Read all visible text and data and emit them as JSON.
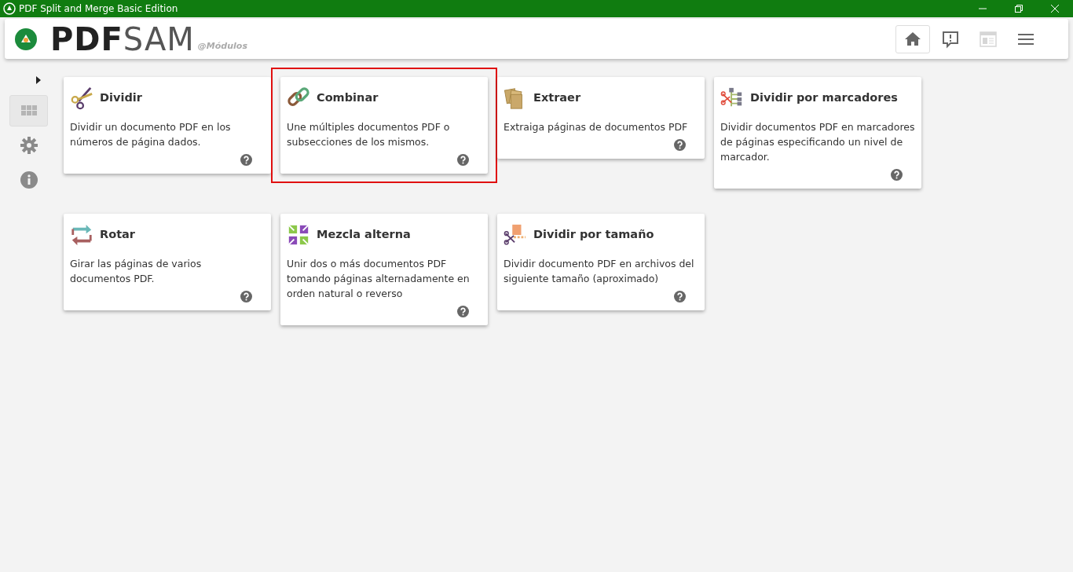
{
  "window": {
    "title": "PDF Split and Merge Basic Edition"
  },
  "header": {
    "logo_dark": "PDF",
    "logo_light": "SAM",
    "section": "@Módulos",
    "buttons": [
      {
        "kind": "home",
        "selected": true,
        "disabled": false
      },
      {
        "kind": "feedback",
        "selected": false,
        "disabled": false
      },
      {
        "kind": "news",
        "selected": false,
        "disabled": true
      },
      {
        "kind": "menu",
        "selected": false,
        "disabled": false
      }
    ]
  },
  "sidebar": {
    "items": [
      {
        "kind": "modules",
        "selected": true
      },
      {
        "kind": "settings",
        "selected": false
      },
      {
        "kind": "info",
        "selected": false
      }
    ]
  },
  "modules": [
    {
      "kind": "split",
      "title": "Dividir",
      "description": "Dividir un documento PDF en los números de página dados.",
      "highlighted": false
    },
    {
      "kind": "merge",
      "title": "Combinar",
      "description": "Une múltiples documentos PDF o subsecciones de los mismos.",
      "highlighted": true
    },
    {
      "kind": "extract",
      "title": "Extraer",
      "description": "Extraiga páginas de documentos PDF",
      "highlighted": false
    },
    {
      "kind": "bookmarks",
      "title": "Dividir por marcadores",
      "description": "Dividir documentos PDF en marcadores de páginas especificando un nivel de marcador.",
      "highlighted": false
    },
    {
      "kind": "rotate",
      "title": "Rotar",
      "description": "Girar las páginas de varios documentos PDF.",
      "highlighted": false
    },
    {
      "kind": "alternate",
      "title": "Mezcla alterna",
      "description": "Unir dos o más documentos PDF tomando páginas alternadamente en orden natural o reverso",
      "highlighted": false
    },
    {
      "kind": "size",
      "title": "Dividir por tamaño",
      "description": "Dividir documento PDF en archivos del siguiente tamaño (aproximado)",
      "highlighted": false
    }
  ]
}
